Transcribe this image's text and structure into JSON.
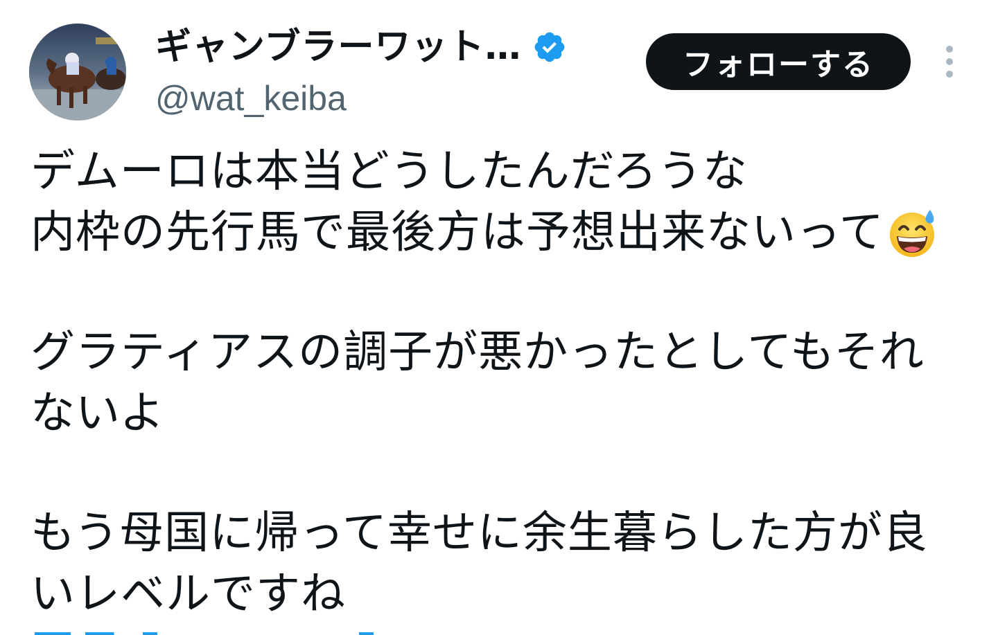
{
  "header": {
    "display_name": "ギャンブラーワット…",
    "handle": "@wat_keiba",
    "verified_icon": "verified-badge-icon",
    "follow_label": "フォローする",
    "more_icon": "more-vertical-icon",
    "avatar_icon": "horse-racing-avatar"
  },
  "tweet": {
    "lines": [
      "デムーロは本当どうしたんだろうな",
      "内枠の先行馬で最後方は予想出来ないって",
      "グラティアスの調子が悪かったとしてもそれ",
      "ないよ",
      "もう母国に帰って幸せに余生暮らした方が良",
      "いレベルですね"
    ],
    "emoji_icon": "grinning-face-with-sweat-icon"
  },
  "colors": {
    "text": "#0f1419",
    "secondary": "#536471",
    "verified": "#1d9bf0",
    "button_bg": "#0f1419",
    "button_text": "#ffffff"
  }
}
